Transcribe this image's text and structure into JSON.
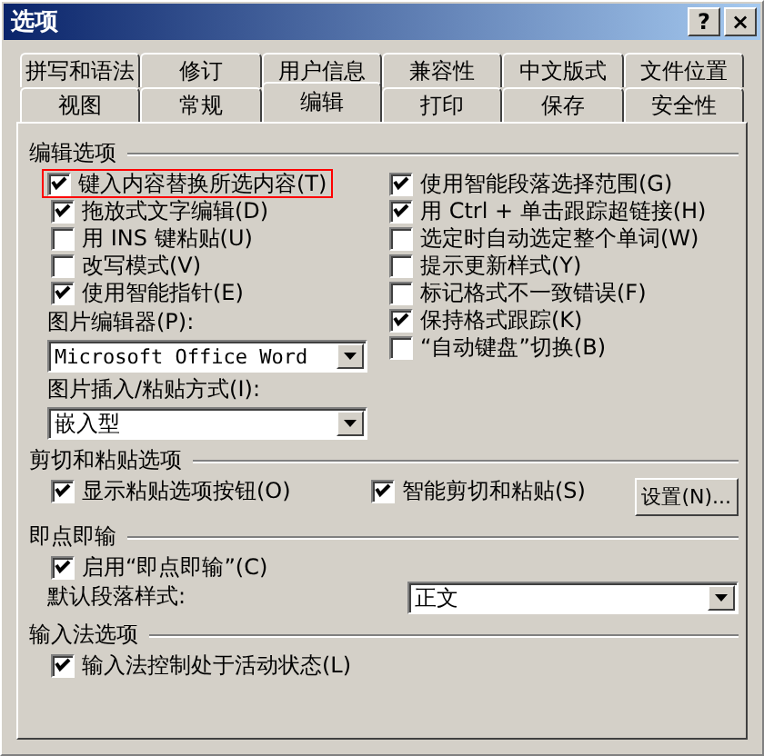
{
  "window": {
    "title": "选项",
    "help": "?",
    "close": "×"
  },
  "tab_rows": [
    [
      {
        "label": "拼写和语法",
        "selected": false
      },
      {
        "label": "修订",
        "selected": false
      },
      {
        "label": "用户信息",
        "selected": false
      },
      {
        "label": "兼容性",
        "selected": false
      },
      {
        "label": "中文版式",
        "selected": false
      },
      {
        "label": "文件位置",
        "selected": false
      }
    ],
    [
      {
        "label": "视图",
        "selected": false
      },
      {
        "label": "常规",
        "selected": false
      },
      {
        "label": "编辑",
        "selected": true
      },
      {
        "label": "打印",
        "selected": false
      },
      {
        "label": "保存",
        "selected": false
      },
      {
        "label": "安全性",
        "selected": false
      }
    ]
  ],
  "edit_options": {
    "title": "编辑选项",
    "left": [
      {
        "label": "键入内容替换所选内容(T)",
        "checked": true,
        "highlighted": true
      },
      {
        "label": "拖放式文字编辑(D)",
        "checked": true,
        "highlighted": false
      },
      {
        "label": "用 INS 键粘贴(U)",
        "checked": false,
        "highlighted": false
      },
      {
        "label": "改写模式(V)",
        "checked": false,
        "highlighted": false
      },
      {
        "label": "使用智能指针(E)",
        "checked": true,
        "highlighted": false
      }
    ],
    "right": [
      {
        "label": "使用智能段落选择范围(G)",
        "checked": true
      },
      {
        "label": "用 Ctrl + 单击跟踪超链接(H)",
        "checked": true
      },
      {
        "label": "选定时自动选定整个单词(W)",
        "checked": false
      },
      {
        "label": "提示更新样式(Y)",
        "checked": false
      },
      {
        "label": "标记格式不一致错误(F)",
        "checked": false
      },
      {
        "label": "保持格式跟踪(K)",
        "checked": true
      },
      {
        "label": "“自动键盘”切换(B)",
        "checked": false
      }
    ],
    "picture_editor": {
      "label": "图片编辑器(P):",
      "value": "Microsoft Office Word"
    },
    "insert_mode": {
      "label": "图片插入/粘贴方式(I):",
      "value": "嵌入型"
    }
  },
  "cut_paste": {
    "title": "剪切和粘贴选项",
    "options": [
      {
        "label": "显示粘贴选项按钮(O)",
        "checked": true
      },
      {
        "label": "智能剪切和粘贴(S)",
        "checked": true
      }
    ],
    "button": "设置(N)..."
  },
  "click_type": {
    "title": "即点即输",
    "option": {
      "label": "启用“即点即输”(C)",
      "checked": true
    },
    "style": {
      "label": "默认段落样式:",
      "value": "正文"
    }
  },
  "ime": {
    "title": "输入法选项",
    "option": {
      "label": "输入法控制处于活动状态(L)",
      "checked": true
    }
  }
}
